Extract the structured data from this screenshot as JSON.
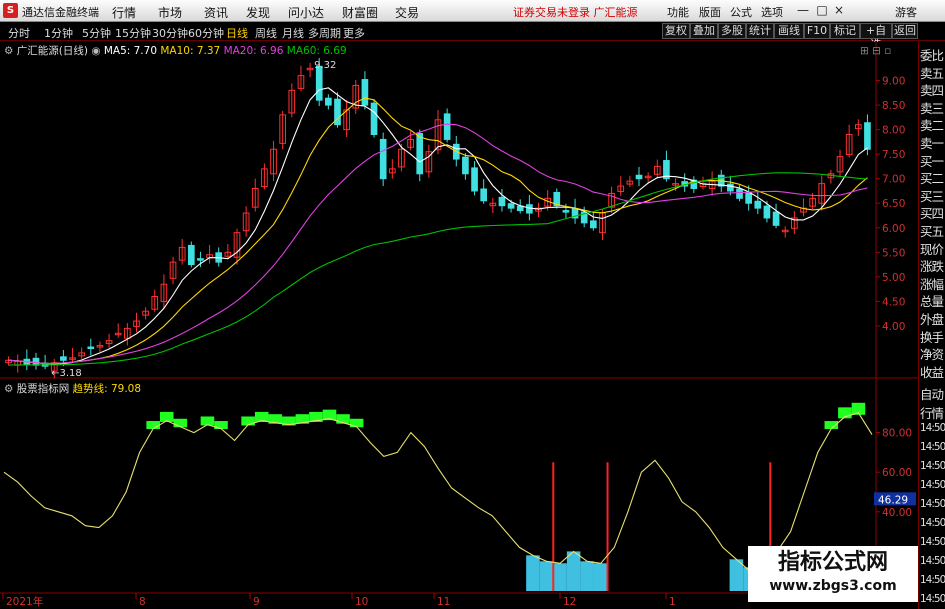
{
  "app": {
    "logo": "S",
    "title": "通达信金融终端"
  },
  "menu": [
    "行情",
    "市场",
    "资讯",
    "发现",
    "问小达",
    "财富圈",
    "交易"
  ],
  "notice": "证券交易未登录  广汇能源",
  "menu_right": [
    "功能",
    "版面",
    "公式",
    "选项"
  ],
  "guest": "游客",
  "window_buttons": [
    "—",
    "□",
    "×"
  ],
  "periods": [
    "分时",
    "1分钟",
    "5分钟",
    "15分钟",
    "30分钟",
    "60分钟",
    "日线",
    "周线",
    "月线",
    "多周期",
    "更多"
  ],
  "active_period": "日线",
  "right_buttons": [
    "复权",
    "叠加",
    "多股",
    "统计",
    "画线",
    "F10",
    "标记",
    "+自选",
    "返回"
  ],
  "main_legend": {
    "stock": "广汇能源(日线)",
    "ma5": "MA5: 7.70",
    "ma10": "MA10: 7.37",
    "ma20": "MA20: 6.96",
    "ma60": "MA60: 6.69"
  },
  "colors": {
    "ma5": "#ffffff",
    "ma10": "#ffd700",
    "ma20": "#e040e0",
    "ma60": "#00c000",
    "up": "#ff3030",
    "down": "#40e0e0",
    "indicator": "#e8e070",
    "bar_green": "#20ff20",
    "bar_cyan": "#40c0e0",
    "bar_red": "#ff2020"
  },
  "price_high_label": "9.32",
  "price_low_label": "3.18",
  "price_axis": [
    "9.00",
    "8.50",
    "8.00",
    "7.50",
    "7.00",
    "6.50",
    "6.00",
    "5.50",
    "5.00",
    "4.50",
    "4.00"
  ],
  "indicator_legend": {
    "name": "股票指标网",
    "line": "趋势线: 79.08"
  },
  "indicator_axis": [
    "80.00",
    "60.00",
    "40.00",
    "20.00"
  ],
  "indicator_current": "46.29",
  "x_axis": [
    "2021年",
    "8",
    "9",
    "10",
    "11",
    "12",
    "1"
  ],
  "side_labels": [
    "委比",
    "卖五",
    "卖四",
    "卖三",
    "卖二",
    "卖一",
    "买一",
    "买二",
    "买三",
    "买四",
    "买五",
    "现价",
    "涨跌",
    "涨幅",
    "总量",
    "外盘",
    "换手",
    "净资",
    "收益"
  ],
  "side_labels_lower": [
    "自动",
    "行情",
    "14:50",
    "14:50",
    "14:50",
    "14:50",
    "14:50",
    "14:50",
    "14:50",
    "14:50",
    "14:50",
    "14:50"
  ],
  "chart_data": [
    {
      "type": "candlestick",
      "title": "广汇能源(日线)",
      "series_names": [
        "MA5",
        "MA10",
        "MA20",
        "MA60"
      ],
      "close": [
        3.3,
        3.28,
        3.22,
        3.2,
        3.18,
        3.25,
        3.3,
        3.35,
        3.45,
        3.55,
        3.6,
        3.7,
        3.85,
        3.95,
        4.1,
        4.3,
        4.6,
        4.85,
        5.3,
        5.6,
        5.25,
        5.35,
        5.45,
        5.3,
        5.5,
        5.9,
        6.3,
        6.8,
        7.2,
        7.6,
        8.3,
        8.8,
        9.1,
        9.25,
        8.6,
        8.5,
        8.1,
        8.4,
        8.9,
        8.5,
        7.9,
        7.0,
        7.2,
        7.6,
        7.8,
        7.1,
        7.55,
        8.2,
        7.8,
        7.4,
        7.1,
        6.75,
        6.55,
        6.5,
        6.45,
        6.4,
        6.35,
        6.3,
        6.4,
        6.6,
        6.45,
        6.35,
        6.2,
        6.1,
        6.0,
        6.3,
        6.7,
        6.85,
        6.95,
        7.0,
        7.05,
        7.25,
        7.0,
        6.9,
        6.85,
        6.8,
        6.9,
        6.95,
        6.85,
        6.75,
        6.6,
        6.5,
        6.4,
        6.2,
        6.05,
        5.95,
        6.2,
        6.4,
        6.6,
        6.9,
        7.1,
        7.45,
        7.9,
        8.1,
        7.6
      ],
      "ma60_start": 3.2,
      "ylim": [
        3.0,
        9.5
      ],
      "high": 9.32,
      "low": 3.18
    },
    {
      "type": "line",
      "title": "股票指标网",
      "series_names": [
        "趋势线"
      ],
      "values": [
        60,
        55,
        48,
        42,
        40,
        38,
        33,
        32,
        38,
        50,
        70,
        82,
        86,
        83,
        80,
        84,
        82,
        76,
        84,
        86,
        85,
        84,
        85,
        86,
        87,
        85,
        83,
        75,
        68,
        70,
        80,
        73,
        62,
        52,
        47,
        42,
        38,
        30,
        22,
        18,
        15,
        14,
        20,
        15,
        14,
        22,
        40,
        60,
        66,
        57,
        45,
        40,
        32,
        22,
        16,
        10,
        14,
        20,
        30,
        50,
        70,
        82,
        88,
        90,
        79
      ],
      "ylim": [
        0,
        100
      ]
    }
  ]
}
